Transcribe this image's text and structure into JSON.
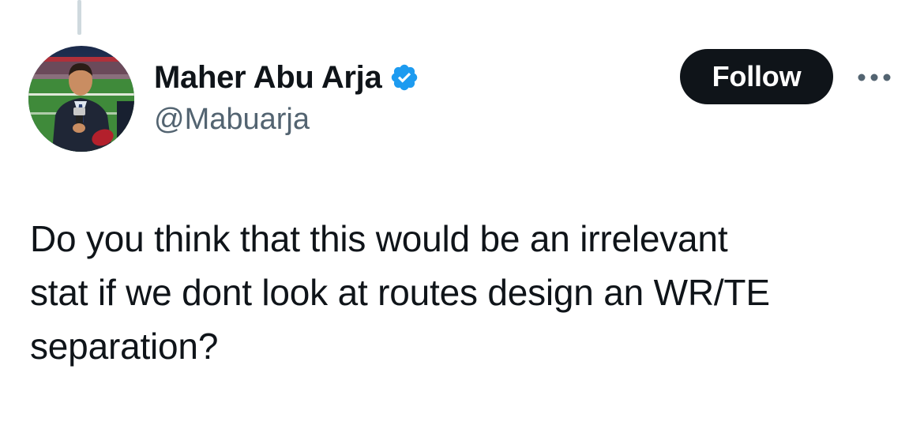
{
  "author": {
    "display_name": "Maher Abu Arja",
    "handle": "@Mabuarja",
    "verified": true,
    "avatar_icon": "profile-photo"
  },
  "actions": {
    "follow_label": "Follow",
    "more_icon": "more-horizontal-icon"
  },
  "tweet": {
    "lines": [
      "Do you think that this would be an irrelevant",
      "stat if we dont look at routes design an WR/TE",
      "separation?"
    ]
  },
  "colors": {
    "verified_blue": "#1d9bf0",
    "follow_bg": "#0f1419",
    "handle_gray": "#536471",
    "thread_line": "#cfd9de"
  }
}
